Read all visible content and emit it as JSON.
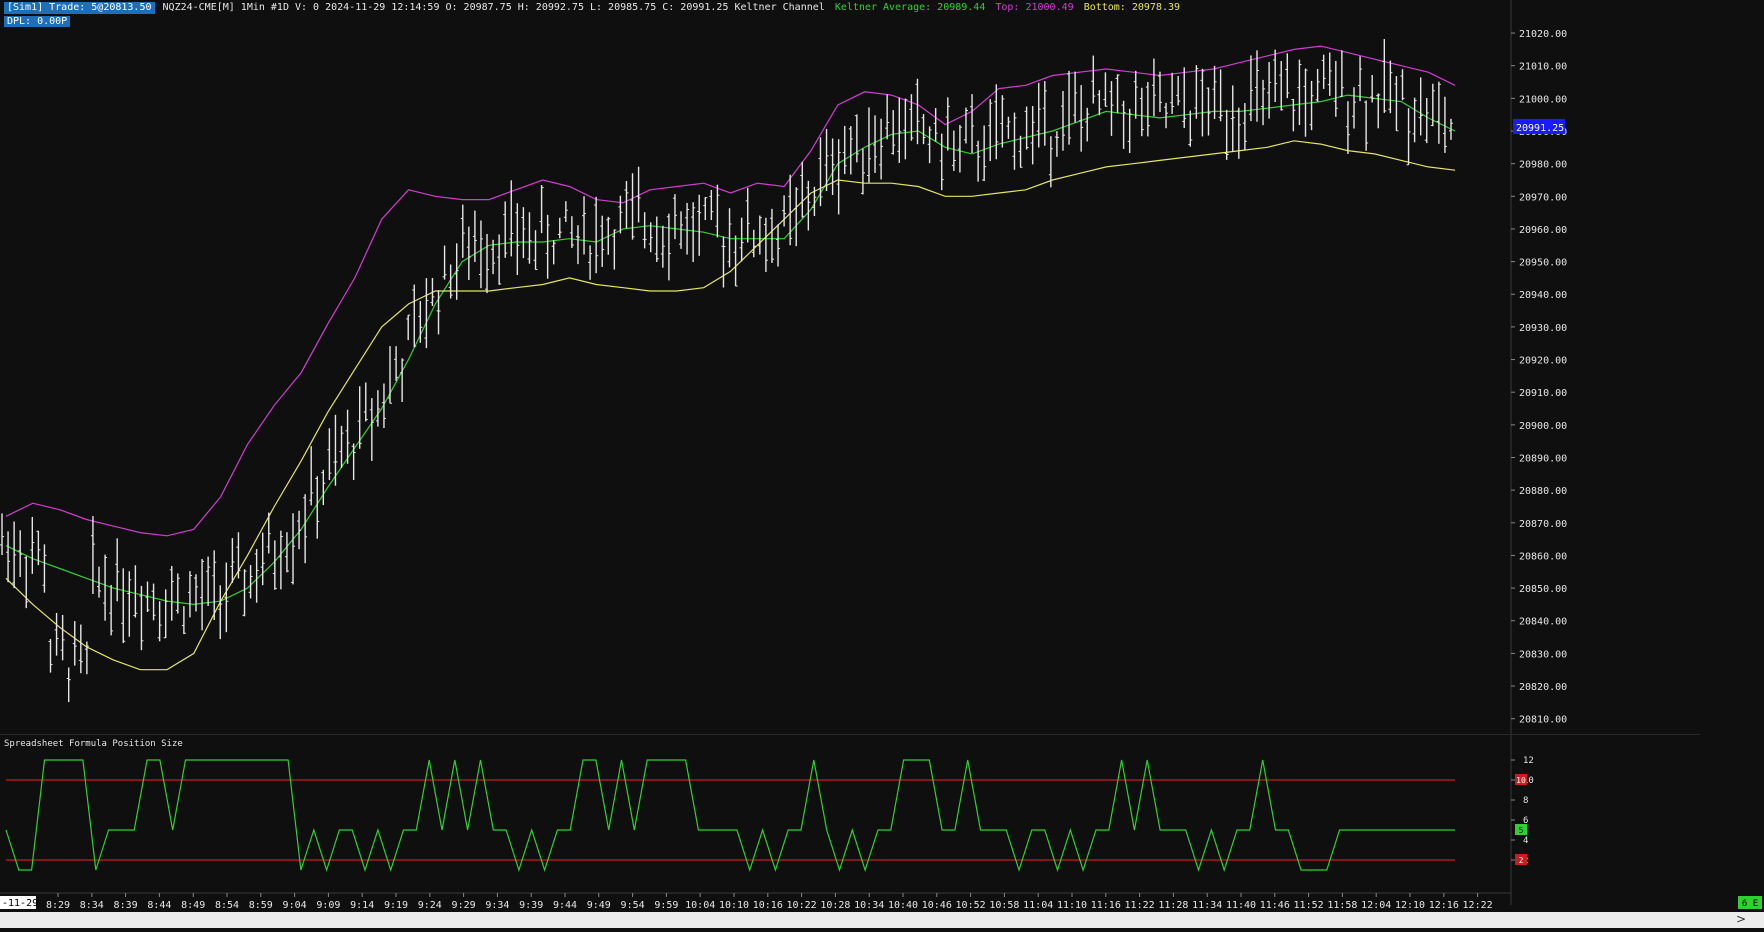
{
  "header": {
    "account_badge": "[Sim1] Trade: 5@20813.50",
    "instrument": "NQZ24-CME[M] 1Min #1D V: 0 2024-11-29 12:14:59 O: 20987.75 H: 20992.75 L: 20985.75 C: 20991.25 Keltner Channel",
    "average_label": "Keltner Average: 20989.44",
    "top_label": "Top: 21000.49",
    "bottom_label": "Bottom: 20978.39",
    "dpl_label": "DPL: 0.00P"
  },
  "colors": {
    "background": "#0f0f0f",
    "bar": "#e6e6e6",
    "average": "#2fd12f",
    "top": "#d23cd2",
    "bottom": "#e5e55a",
    "position": "#2fd12f",
    "threshold": "#c81e1e",
    "last_price_bg": "#1a1aff"
  },
  "price_axis": {
    "ticks": [
      "21020.00",
      "21010.00",
      "21000.00",
      "20990.00",
      "20980.00",
      "20970.00",
      "20960.00",
      "20950.00",
      "20940.00",
      "20930.00",
      "20920.00",
      "20910.00",
      "20900.00",
      "20890.00",
      "20880.00",
      "20870.00",
      "20860.00",
      "20850.00",
      "20840.00",
      "20830.00",
      "20820.00",
      "20810.00"
    ],
    "last_price": "20991.25"
  },
  "time_axis": {
    "labels": [
      "-11-29",
      "8:29",
      "8:34",
      "8:39",
      "8:44",
      "8:49",
      "8:54",
      "8:59",
      "9:04",
      "9:09",
      "9:14",
      "9:19",
      "9:24",
      "9:29",
      "9:34",
      "9:39",
      "9:44",
      "9:49",
      "9:54",
      "9:59",
      "10:04",
      "10:10",
      "10:16",
      "10:22",
      "10:28",
      "10:34",
      "10:40",
      "10:46",
      "10:52",
      "10:58",
      "11:04",
      "11:10",
      "11:16",
      "11:22",
      "11:28",
      "11:34",
      "11:40",
      "11:46",
      "11:52",
      "11:58",
      "12:04",
      "12:10",
      "12:16",
      "12:22"
    ],
    "corner_label": "6 E"
  },
  "subpanel": {
    "title": "Spreadsheet Formula Position Size",
    "axis_ticks": [
      "12",
      "10",
      "8",
      "6",
      "4",
      "2"
    ],
    "upper_badge": "10",
    "current_badge": "5",
    "lower_badge": "2"
  },
  "chart_data": [
    {
      "type": "line",
      "chart_kind": "ohlc-bars with Keltner Channel",
      "title": "NQZ24-CME[M] 1Min",
      "ylim": [
        20805,
        21024
      ],
      "series": [
        {
          "name": "Keltner Average",
          "values": [
            20863,
            20859,
            20856,
            20853,
            20850,
            20848,
            20846,
            20845,
            20846,
            20850,
            20858,
            20868,
            20881,
            20893,
            20905,
            20920,
            20937,
            20950,
            20955,
            20956,
            20956,
            20957,
            20956,
            20960,
            20961,
            20960,
            20959,
            20957,
            20957,
            20957,
            20966,
            20980,
            20985,
            20989,
            20990,
            20985,
            20983,
            20986,
            20988,
            20990,
            20993,
            20996,
            20995,
            20994,
            20995,
            20996,
            20996,
            20997,
            20998,
            20999,
            21001,
            21000,
            20999,
            20994,
            20990
          ]
        },
        {
          "name": "Top",
          "values": [
            20872,
            20876,
            20874,
            20871,
            20869,
            20867,
            20866,
            20868,
            20878,
            20894,
            20906,
            20916,
            20931,
            20945,
            20963,
            20972,
            20970,
            20969,
            20969,
            20972,
            20975,
            20973,
            20969,
            20968,
            20972,
            20973,
            20974,
            20971,
            20974,
            20973,
            20984,
            20998,
            21002,
            21001,
            20998,
            20992,
            20996,
            21003,
            21004,
            21007,
            21008,
            21009,
            21008,
            21007,
            21008,
            21009,
            21011,
            21013,
            21015,
            21016,
            21014,
            21012,
            21010,
            21008,
            21004
          ]
        },
        {
          "name": "Bottom",
          "values": [
            20853,
            20845,
            20838,
            20832,
            20828,
            20825,
            20825,
            20830,
            20846,
            20860,
            20875,
            20889,
            20904,
            20917,
            20930,
            20937,
            20941,
            20941,
            20941,
            20942,
            20943,
            20945,
            20943,
            20942,
            20941,
            20941,
            20942,
            20947,
            20955,
            20963,
            20971,
            20975,
            20974,
            20974,
            20973,
            20970,
            20970,
            20971,
            20972,
            20975,
            20977,
            20979,
            20980,
            20981,
            20982,
            20983,
            20984,
            20985,
            20987,
            20986,
            20984,
            20983,
            20981,
            20979,
            20978
          ]
        }
      ]
    },
    {
      "type": "line",
      "title": "Spreadsheet Formula Position Size",
      "ylim": [
        0,
        13
      ],
      "series": [
        {
          "name": "Position Size",
          "values": [
            5,
            1,
            1,
            12,
            12,
            12,
            12,
            1,
            5,
            5,
            5,
            12,
            12,
            5,
            12,
            12,
            12,
            12,
            12,
            12,
            12,
            12,
            12,
            1,
            5,
            1,
            5,
            5,
            1,
            5,
            1,
            5,
            5,
            12,
            5,
            12,
            5,
            12,
            5,
            5,
            1,
            5,
            1,
            5,
            5,
            12,
            12,
            5,
            12,
            5,
            12,
            12,
            12,
            12,
            5,
            5,
            5,
            5,
            1,
            5,
            1,
            5,
            5,
            12,
            5,
            1,
            5,
            1,
            5,
            5,
            12,
            12,
            12,
            5,
            5,
            12,
            5,
            5,
            5,
            1,
            5,
            5,
            1,
            5,
            1,
            5,
            5,
            12,
            5,
            12,
            5,
            5,
            5,
            1,
            5,
            1,
            5,
            5,
            12,
            5,
            5,
            1,
            1,
            1,
            5,
            5,
            5,
            5,
            5,
            5,
            5,
            5,
            5,
            5
          ]
        },
        {
          "name": "Upper",
          "values": [
            10
          ]
        },
        {
          "name": "Lower",
          "values": [
            2
          ]
        }
      ]
    }
  ]
}
